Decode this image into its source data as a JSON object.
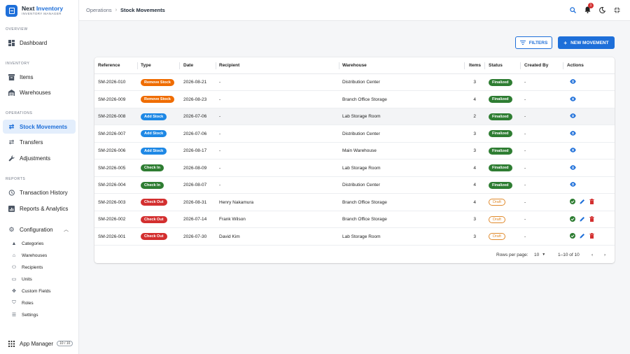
{
  "brand": {
    "title_a": "Next",
    "title_b": "Inventory",
    "subtitle": "INVENTORY MANAGER"
  },
  "sidebar": {
    "sections": {
      "overview": "OVERVIEW",
      "inventory": "INVENTORY",
      "operations": "OPERATIONS",
      "reports": "REPORTS"
    },
    "items": {
      "dashboard": "Dashboard",
      "items": "Items",
      "warehouses": "Warehouses",
      "stock_movements": "Stock Movements",
      "transfers": "Transfers",
      "adjustments": "Adjustments",
      "transaction_history": "Transaction History",
      "reports_analytics": "Reports & Analytics",
      "configuration": "Configuration",
      "app_manager": "App Manager",
      "app_manager_count": "10 / 10"
    },
    "config_items": {
      "categories": "Categories",
      "warehouses": "Warehouses",
      "recipients": "Recipients",
      "units": "Units",
      "custom_fields": "Custom Fields",
      "roles": "Roles",
      "settings": "Settings"
    }
  },
  "header": {
    "breadcrumb_parent": "Operations",
    "breadcrumb_current": "Stock Movements",
    "notification_count": "1"
  },
  "toolbar": {
    "filters_label": "FILTERS",
    "new_label": "NEW MOVEMENT"
  },
  "colors": {
    "accent": "#1e6fd9",
    "remove_stock": "#ef6c00",
    "add_stock": "#1e88e5",
    "check_in": "#2e7d32",
    "check_out": "#d32f2f",
    "finalized": "#2e7d32",
    "draft": "#e08a2c"
  },
  "table": {
    "headers": {
      "reference": "Reference",
      "type": "Type",
      "date": "Date",
      "recipient": "Recipient",
      "warehouse": "Warehouse",
      "items": "Items",
      "status": "Status",
      "created_by": "Created By",
      "actions": "Actions"
    },
    "rows": [
      {
        "ref": "SM-2026-010",
        "type": "Remove Stock",
        "type_color": "#ef6c00",
        "date": "2026-08-21",
        "recipient": "-",
        "warehouse": "Distribution Center",
        "items": "3",
        "status": "Finalized",
        "created_by": "-"
      },
      {
        "ref": "SM-2026-009",
        "type": "Remove Stock",
        "type_color": "#ef6c00",
        "date": "2026-08-23",
        "recipient": "-",
        "warehouse": "Branch Office Storage",
        "items": "4",
        "status": "Finalized",
        "created_by": "-"
      },
      {
        "ref": "SM-2026-008",
        "type": "Add Stock",
        "type_color": "#1e88e5",
        "date": "2026-07-06",
        "recipient": "-",
        "warehouse": "Lab Storage Room",
        "items": "2",
        "status": "Finalized",
        "created_by": "-"
      },
      {
        "ref": "SM-2026-007",
        "type": "Add Stock",
        "type_color": "#1e88e5",
        "date": "2026-07-06",
        "recipient": "-",
        "warehouse": "Distribution Center",
        "items": "3",
        "status": "Finalized",
        "created_by": "-"
      },
      {
        "ref": "SM-2026-006",
        "type": "Add Stock",
        "type_color": "#1e88e5",
        "date": "2026-08-17",
        "recipient": "-",
        "warehouse": "Main Warehouse",
        "items": "3",
        "status": "Finalized",
        "created_by": "-"
      },
      {
        "ref": "SM-2026-005",
        "type": "Check In",
        "type_color": "#2e7d32",
        "date": "2026-08-09",
        "recipient": "-",
        "warehouse": "Lab Storage Room",
        "items": "4",
        "status": "Finalized",
        "created_by": "-"
      },
      {
        "ref": "SM-2026-004",
        "type": "Check In",
        "type_color": "#2e7d32",
        "date": "2026-08-07",
        "recipient": "-",
        "warehouse": "Distribution Center",
        "items": "4",
        "status": "Finalized",
        "created_by": "-"
      },
      {
        "ref": "SM-2026-003",
        "type": "Check Out",
        "type_color": "#d32f2f",
        "date": "2026-08-31",
        "recipient": "Henry Nakamura",
        "warehouse": "Branch Office Storage",
        "items": "4",
        "status": "Draft",
        "created_by": "-"
      },
      {
        "ref": "SM-2026-002",
        "type": "Check Out",
        "type_color": "#d32f2f",
        "date": "2026-07-14",
        "recipient": "Frank Wilson",
        "warehouse": "Branch Office Storage",
        "items": "3",
        "status": "Draft",
        "created_by": "-"
      },
      {
        "ref": "SM-2026-001",
        "type": "Check Out",
        "type_color": "#d32f2f",
        "date": "2026-07-30",
        "recipient": "David Kim",
        "warehouse": "Lab Storage Room",
        "items": "3",
        "status": "Draft",
        "created_by": "-"
      }
    ],
    "footer": {
      "rows_per_page_label": "Rows per page:",
      "rows_per_page_value": "10",
      "range": "1–10 of 10"
    }
  }
}
